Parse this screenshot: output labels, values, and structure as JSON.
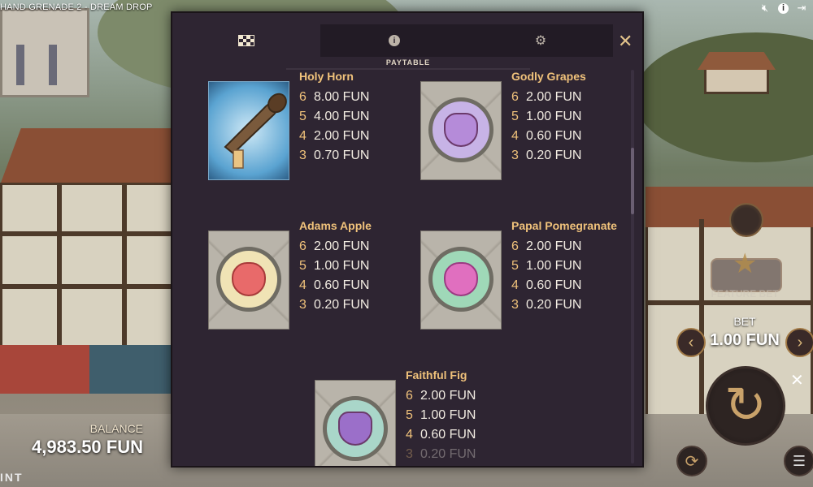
{
  "game": {
    "title": "HAND GRENADE 2 - DREAM DROP",
    "brand": "INT"
  },
  "top_icons": [
    "mute-icon",
    "info-icon",
    "exit-icon"
  ],
  "balance": {
    "label": "BALANCE",
    "value": "4,983.50 FUN"
  },
  "controls": {
    "feature_label": "FEATURE BET",
    "bet_label": "BET",
    "bet_value": "1.00 FUN",
    "bet_decrease": "‹",
    "bet_increase": "›"
  },
  "modal": {
    "tabs": [
      {
        "name": "paytable",
        "icon": "checkerboard-icon",
        "active": true
      },
      {
        "name": "info",
        "icon": "info-icon",
        "active": false
      },
      {
        "name": "settings",
        "icon": "gear-icon",
        "active": false
      }
    ],
    "caption": "PAYTABLE",
    "close": "✕",
    "symbols": [
      {
        "name": "Holy Horn",
        "icon": "horn-icon",
        "pays": [
          {
            "count": "6",
            "amount": "8.00 FUN"
          },
          {
            "count": "5",
            "amount": "4.00 FUN"
          },
          {
            "count": "4",
            "amount": "2.00 FUN"
          },
          {
            "count": "3",
            "amount": "0.70 FUN"
          }
        ]
      },
      {
        "name": "Godly Grapes",
        "icon": "grapes-icon",
        "pays": [
          {
            "count": "6",
            "amount": "2.00 FUN"
          },
          {
            "count": "5",
            "amount": "1.00 FUN"
          },
          {
            "count": "4",
            "amount": "0.60 FUN"
          },
          {
            "count": "3",
            "amount": "0.20 FUN"
          }
        ]
      },
      {
        "name": "Adams Apple",
        "icon": "apple-icon",
        "pays": [
          {
            "count": "6",
            "amount": "2.00 FUN"
          },
          {
            "count": "5",
            "amount": "1.00 FUN"
          },
          {
            "count": "4",
            "amount": "0.60 FUN"
          },
          {
            "count": "3",
            "amount": "0.20 FUN"
          }
        ]
      },
      {
        "name": "Papal Pomegranate",
        "icon": "pomegranate-icon",
        "pays": [
          {
            "count": "6",
            "amount": "2.00 FUN"
          },
          {
            "count": "5",
            "amount": "1.00 FUN"
          },
          {
            "count": "4",
            "amount": "0.60 FUN"
          },
          {
            "count": "3",
            "amount": "0.20 FUN"
          }
        ]
      },
      {
        "name": "Faithful Fig",
        "icon": "fig-icon",
        "pays": [
          {
            "count": "6",
            "amount": "2.00 FUN"
          },
          {
            "count": "5",
            "amount": "1.00 FUN"
          },
          {
            "count": "4",
            "amount": "0.60 FUN"
          },
          {
            "count": "3",
            "amount": "0.20 FUN"
          }
        ]
      }
    ]
  },
  "colors": {
    "modal_bg": "#2e2532",
    "symbol_name": "#f0c27b",
    "pay_text": "#f2ece2",
    "grapes": "#b58bd9",
    "apple_bg": "#f0e3b5",
    "apple": "#e86a6a",
    "pomegranate_bg": "#9fd8b8",
    "pomegranate": "#e06fbf",
    "fig_bg": "#a9d6c9",
    "fig": "#9b6fc9"
  }
}
